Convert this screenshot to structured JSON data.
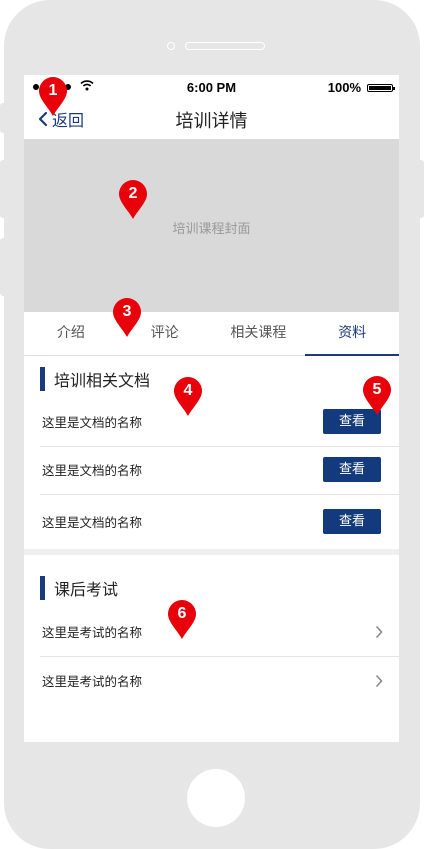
{
  "status_bar": {
    "time": "6:00 PM",
    "battery": "100%"
  },
  "nav": {
    "back_label": "返回",
    "title": "培训详情"
  },
  "cover": {
    "label": "培训课程封面"
  },
  "tabs": [
    {
      "label": "介绍",
      "active": false
    },
    {
      "label": "评论",
      "active": false
    },
    {
      "label": "相关课程",
      "active": false
    },
    {
      "label": "资料",
      "active": true
    }
  ],
  "documents": {
    "title": "培训相关文档",
    "items": [
      {
        "name": "这里是文档的名称",
        "button": "查看"
      },
      {
        "name": "这里是文档的名称",
        "button": "查看"
      },
      {
        "name": "这里是文档的名称",
        "button": "查看"
      }
    ]
  },
  "exams": {
    "title": "课后考试",
    "items": [
      {
        "name": "这里是考试的名称"
      },
      {
        "name": "这里是考试的名称"
      }
    ]
  },
  "annotations": [
    "1",
    "2",
    "3",
    "4",
    "5",
    "6"
  ],
  "colors": {
    "accent": "#143a7e",
    "marker": "#e8000b"
  }
}
